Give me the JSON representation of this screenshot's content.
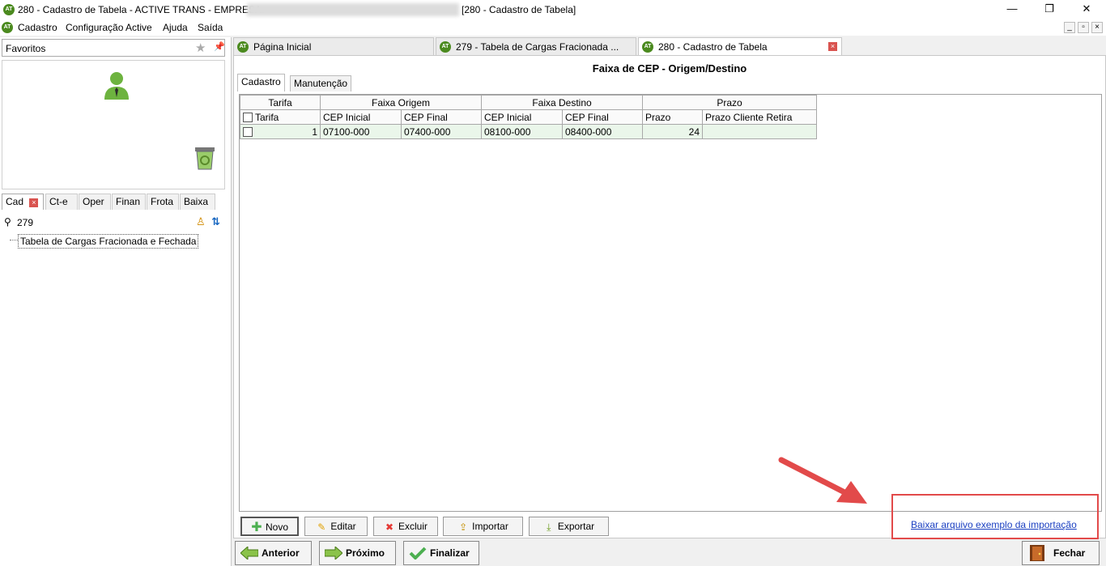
{
  "window": {
    "title": "280 - Cadastro de Tabela - ACTIVE TRANS - EMPRESA:",
    "title_suffix": "[280 - Cadastro de Tabela]",
    "minimize": "—",
    "maximize": "❐",
    "close": "✕"
  },
  "menu": {
    "items": [
      "Cadastro",
      "Configuração Active",
      "Ajuda",
      "Saída"
    ]
  },
  "logo_text": "AT",
  "left": {
    "favorites_label": "Favoritos",
    "tabs": [
      "Cad",
      "Ct-e",
      "Oper",
      "Finan",
      "Frota",
      "Baixa"
    ],
    "search_value": "279",
    "tree_item": "Tabela de Cargas Fracionada e Fechada"
  },
  "main_tabs": [
    {
      "label": "Página Inicial"
    },
    {
      "label": "279 - Tabela de Cargas Fracionada ..."
    },
    {
      "label": "280 - Cadastro de Tabela"
    }
  ],
  "form": {
    "title": "Faixa de CEP - Origem/Destino",
    "tabs": [
      "Cadastro",
      "Manutenção"
    ],
    "grid": {
      "group_headers": [
        "Tarifa",
        "Faixa Origem",
        "Faixa Destino",
        "Prazo"
      ],
      "columns": [
        "Tarifa",
        "CEP Inicial",
        "CEP Final",
        "CEP Inicial",
        "CEP Final",
        "Prazo",
        "Prazo Cliente Retira"
      ],
      "rows": [
        {
          "tarifa": "1",
          "origem_inicial": "07100-000",
          "origem_final": "07400-000",
          "destino_inicial": "08100-000",
          "destino_final": "08400-000",
          "prazo": "24",
          "prazo_cliente": ""
        }
      ]
    },
    "buttons": {
      "novo": "Novo",
      "editar": "Editar",
      "excluir": "Excluir",
      "importar": "Importar",
      "exportar": "Exportar"
    },
    "download_link": "Baixar arquivo exemplo da importação"
  },
  "nav": {
    "anterior": "Anterior",
    "proximo": "Próximo",
    "finalizar": "Finalizar",
    "fechar": "Fechar"
  },
  "colors": {
    "logo_green": "#4b8a1f",
    "highlight_red": "#e24a4a",
    "row_green": "#eaf6ea",
    "link_blue": "#1a3fc1"
  }
}
